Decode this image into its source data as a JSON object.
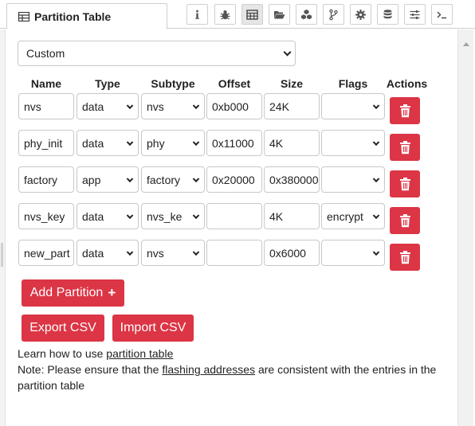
{
  "tab": {
    "title": "Partition Table"
  },
  "toolbar": {
    "buttons": [
      {
        "name": "info",
        "icon": "info-icon"
      },
      {
        "name": "debug",
        "icon": "bug-icon"
      },
      {
        "name": "partition-table",
        "icon": "table-icon",
        "active": true
      },
      {
        "name": "files",
        "icon": "folder-open-icon"
      },
      {
        "name": "components",
        "icon": "cubes-icon"
      },
      {
        "name": "git",
        "icon": "code-branch-icon"
      },
      {
        "name": "settings",
        "icon": "gear-icon"
      },
      {
        "name": "storage",
        "icon": "database-icon"
      },
      {
        "name": "options",
        "icon": "sliders-icon"
      },
      {
        "name": "terminal",
        "icon": "terminal-icon"
      }
    ]
  },
  "table_type": {
    "selected": "Custom"
  },
  "headers": {
    "name": "Name",
    "type": "Type",
    "subtype": "Subtype",
    "offset": "Offset",
    "size": "Size",
    "flags": "Flags",
    "actions": "Actions"
  },
  "rows": [
    {
      "name": "nvs",
      "type": "data",
      "subtype": "nvs",
      "offset": "0xb000",
      "size": "24K",
      "flags": ""
    },
    {
      "name": "phy_init",
      "type": "data",
      "subtype": "phy",
      "offset": "0x11000",
      "size": "4K",
      "flags": ""
    },
    {
      "name": "factory",
      "type": "app",
      "subtype": "factory",
      "offset": "0x20000",
      "size": "0x380000",
      "flags": ""
    },
    {
      "name": "nvs_key",
      "type": "data",
      "subtype": "nvs_ke",
      "offset": "",
      "size": "4K",
      "flags": "encrypt"
    },
    {
      "name": "new_part",
      "type": "data",
      "subtype": "nvs",
      "offset": "",
      "size": "0x6000",
      "flags": ""
    }
  ],
  "buttons": {
    "add_partition": "Add Partition",
    "export_csv": "Export CSV",
    "import_csv": "Import CSV"
  },
  "help": {
    "line1_link": "Learn how to use partition table",
    "line1_prefix": "Learn how to use",
    "line1_link_text": "partition table",
    "note_prefix": "Note: Please ensure that the",
    "note_link": "flashing addresses",
    "note_suffix": "are consistent with the entries in the partition table"
  },
  "colors": {
    "accent": "#dc3545",
    "border": "#c8c8c8"
  }
}
